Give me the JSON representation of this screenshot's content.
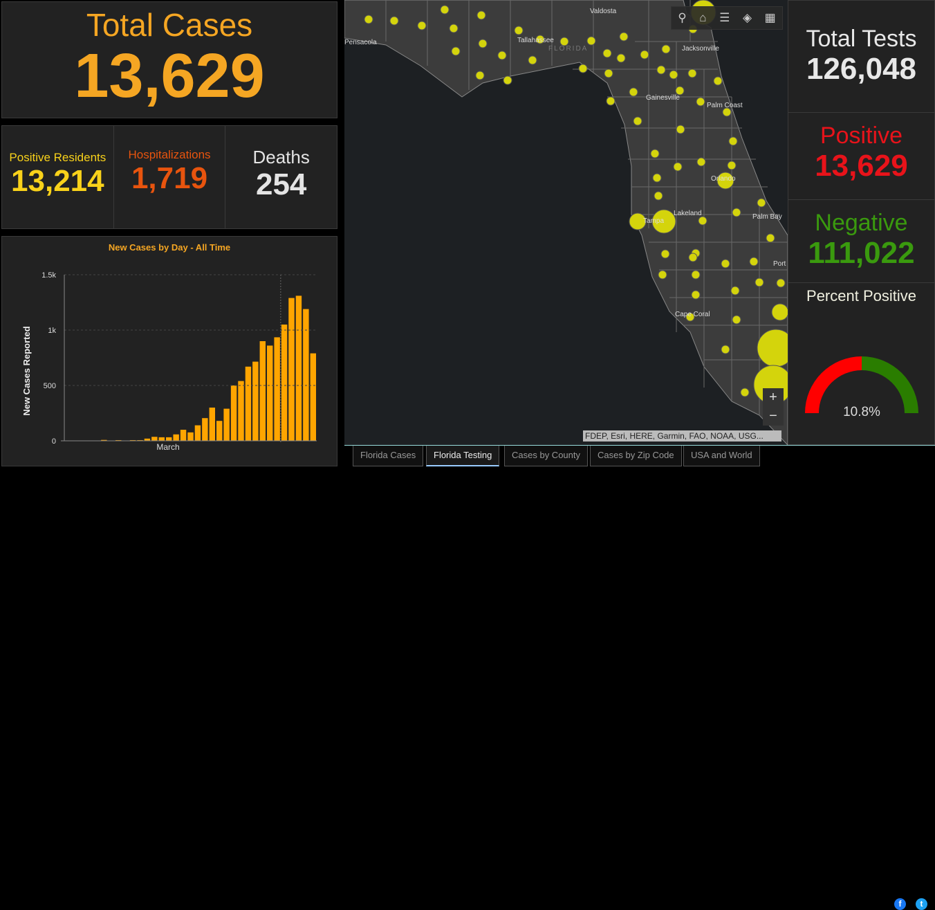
{
  "total_cases": {
    "label": "Total Cases",
    "value": "13,629",
    "color": "#f5a623"
  },
  "stats": [
    {
      "label": "Positive Residents",
      "value": "13,214",
      "color": "#f9d21a"
    },
    {
      "label": "Hospitalizations",
      "value": "1,719",
      "color": "#e8540e"
    },
    {
      "label": "Deaths",
      "value": "254",
      "color": "#e4e4e4"
    }
  ],
  "chart_data": {
    "type": "bar",
    "title": "New Cases by Day - All Time",
    "xlabel": "",
    "ylabel": "New Cases Reported",
    "ylim": [
      0,
      1500
    ],
    "yticks": [
      "0",
      "500",
      "1k",
      "1.5k"
    ],
    "x_tick_label": "March",
    "grid": true,
    "values": [
      2,
      0,
      0,
      2,
      0,
      8,
      3,
      6,
      2,
      6,
      6,
      20,
      36,
      32,
      32,
      58,
      100,
      76,
      140,
      205,
      300,
      180,
      290,
      500,
      540,
      670,
      715,
      900,
      860,
      935,
      1050,
      1290,
      1310,
      1190,
      790
    ],
    "color": "#ffa500"
  },
  "map": {
    "labels": [
      "Valdosta",
      "Pensacola",
      "Tallahassee",
      "FLORIDA",
      "Jacksonville",
      "Gainesville",
      "Palm Coast",
      "Orlando",
      "Lakeland",
      "Tampa",
      "Palm Bay",
      "Port St. Lucie",
      "Cape Coral"
    ],
    "toolbar": [
      "search-icon",
      "home-icon",
      "legend-icon",
      "layers-icon",
      "basemap-gallery-icon"
    ],
    "zoom_in": "+",
    "zoom_out": "−",
    "attribution": "FDEP, Esri, HERE, Garmin, FAO, NOAA, USG...",
    "marker_color": "#d4d40c"
  },
  "tests": {
    "total": {
      "label": "Total Tests",
      "value": "126,048",
      "color": "#e8e8e8"
    },
    "positive": {
      "label": "Positive",
      "value": "13,629",
      "color": "#e8131a"
    },
    "negative": {
      "label": "Negative",
      "value": "111,022",
      "color": "#3a9a0e"
    },
    "percent": {
      "label": "Percent Positive",
      "value": "10.8%",
      "red": "#ff0000",
      "green": "#2a7d00"
    }
  },
  "tabs": [
    {
      "label": "Florida Cases",
      "active": false
    },
    {
      "label": "Florida Testing",
      "active": true
    },
    {
      "label": "Cases by County",
      "active": false
    },
    {
      "label": "Cases by Zip Code",
      "active": false
    },
    {
      "label": "USA and World",
      "active": false
    }
  ],
  "social": {
    "facebook": "f",
    "twitter": "t",
    "facebook_color": "#1877f2",
    "twitter_color": "#1da1f2"
  }
}
